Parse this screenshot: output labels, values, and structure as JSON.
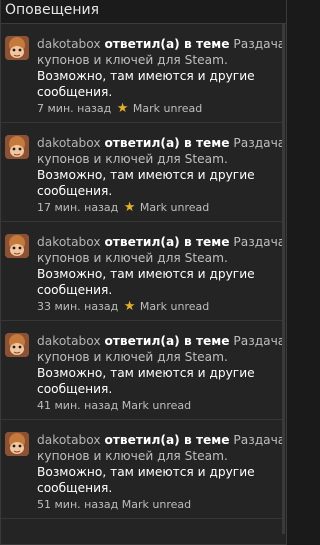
{
  "header": {
    "title": "Оповещения"
  },
  "notifications": [
    {
      "user": "dakotabox",
      "action": "ответил(а) в теме",
      "topic_line1": "Раздача",
      "topic_line2": "купонов и ключей для Steam.",
      "message_line1": "Возможно, там имеются и другие",
      "message_line2": "сообщения.",
      "time": "7 мин. назад",
      "star": true,
      "mark": "Mark unread"
    },
    {
      "user": "dakotabox",
      "action": "ответил(а) в теме",
      "topic_line1": "Раздача",
      "topic_line2": "купонов и ключей для Steam.",
      "message_line1": "Возможно, там имеются и другие",
      "message_line2": "сообщения.",
      "time": "17 мин. назад",
      "star": true,
      "mark": "Mark unread"
    },
    {
      "user": "dakotabox",
      "action": "ответил(а) в теме",
      "topic_line1": "Раздача",
      "topic_line2": "купонов и ключей для Steam.",
      "message_line1": "Возможно, там имеются и другие",
      "message_line2": "сообщения.",
      "time": "33 мин. назад",
      "star": true,
      "mark": "Mark unread"
    },
    {
      "user": "dakotabox",
      "action": "ответил(а) в теме",
      "topic_line1": "Раздача",
      "topic_line2": "купонов и ключей для Steam.",
      "message_line1": "Возможно, там имеются и другие",
      "message_line2": "сообщения.",
      "time": "41 мин. назад",
      "star": false,
      "mark": "Mark unread"
    },
    {
      "user": "dakotabox",
      "action": "ответил(а) в теме",
      "topic_line1": "Раздача",
      "topic_line2": "купонов и ключей для Steam.",
      "message_line1": "Возможно, там имеются и другие",
      "message_line2": "сообщения.",
      "time": "51 мин. назад",
      "star": false,
      "mark": "Mark unread"
    }
  ],
  "colors": {
    "star": "#e3b02c",
    "background": "#242424"
  }
}
